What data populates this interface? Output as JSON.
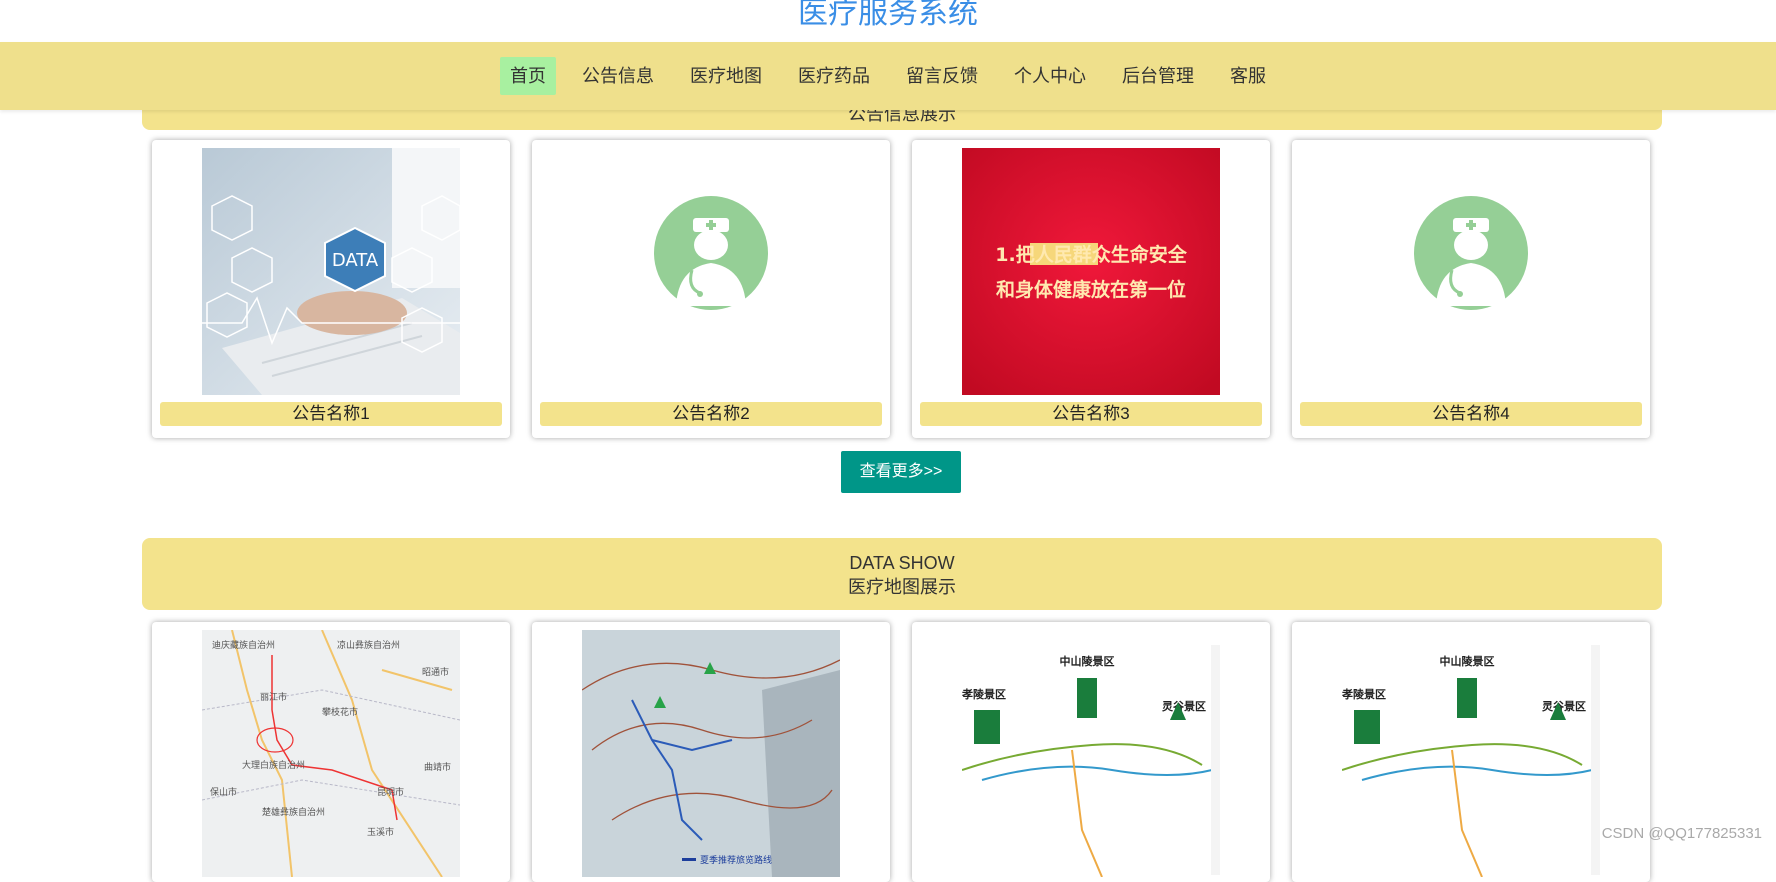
{
  "site": {
    "title": "医疗服务系统"
  },
  "nav": {
    "items": [
      {
        "label": "首页",
        "active": true
      },
      {
        "label": "公告信息"
      },
      {
        "label": "医疗地图"
      },
      {
        "label": "医疗药品"
      },
      {
        "label": "留言反馈"
      },
      {
        "label": "个人中心"
      },
      {
        "label": "后台管理"
      },
      {
        "label": "客服"
      }
    ]
  },
  "notices": {
    "banner_sub": "公告信息展示",
    "cards": [
      {
        "label": "公告名称1",
        "image": "data-laptop-image"
      },
      {
        "label": "公告名称2",
        "image": "doctor-avatar-icon"
      },
      {
        "label": "公告名称3",
        "image": "red-poster-image",
        "poster_line1": "1.把人民群众生命安全",
        "poster_line2": "和身体健康放在第一位"
      },
      {
        "label": "公告名称4",
        "image": "doctor-avatar-icon"
      }
    ],
    "image_text": "DATA",
    "more_label": "查看更多>>"
  },
  "maps": {
    "banner_en": "DATA SHOW",
    "banner_cn": "医疗地图展示",
    "cards": [
      {
        "image": "regional-map-image",
        "place_1": "迪庆藏族自治州",
        "place_2": "凉山彝族自治州",
        "place_3": "昭通市",
        "place_4": "丽江市",
        "place_5": "攀枝花市",
        "place_6": "大理白族自治州",
        "place_7": "昆明市",
        "place_8": "曲靖市",
        "place_9": "保山市",
        "place_10": "楚雄彝族自治州",
        "place_11": "玉溪市"
      },
      {
        "image": "trail-map-image",
        "legend": "夏季推荐旅览路线"
      },
      {
        "image": "scenic-route-map-image",
        "title": "中山陵景区",
        "left": "孝陵景区",
        "right": "灵谷景区"
      },
      {
        "image": "scenic-route-map-image",
        "title": "中山陵景区",
        "left": "孝陵景区",
        "right": "灵谷景区"
      }
    ]
  },
  "watermark": "CSDN @QQ177825331",
  "colors": {
    "title": "#3a8ee6",
    "nav_bg": "#efe08c",
    "nav_active": "#a8f0a0",
    "banner_bg": "#f3e38c",
    "button_bg": "#009688",
    "doctor_circle": "#95cf96",
    "poster_red": "#e0102c"
  }
}
